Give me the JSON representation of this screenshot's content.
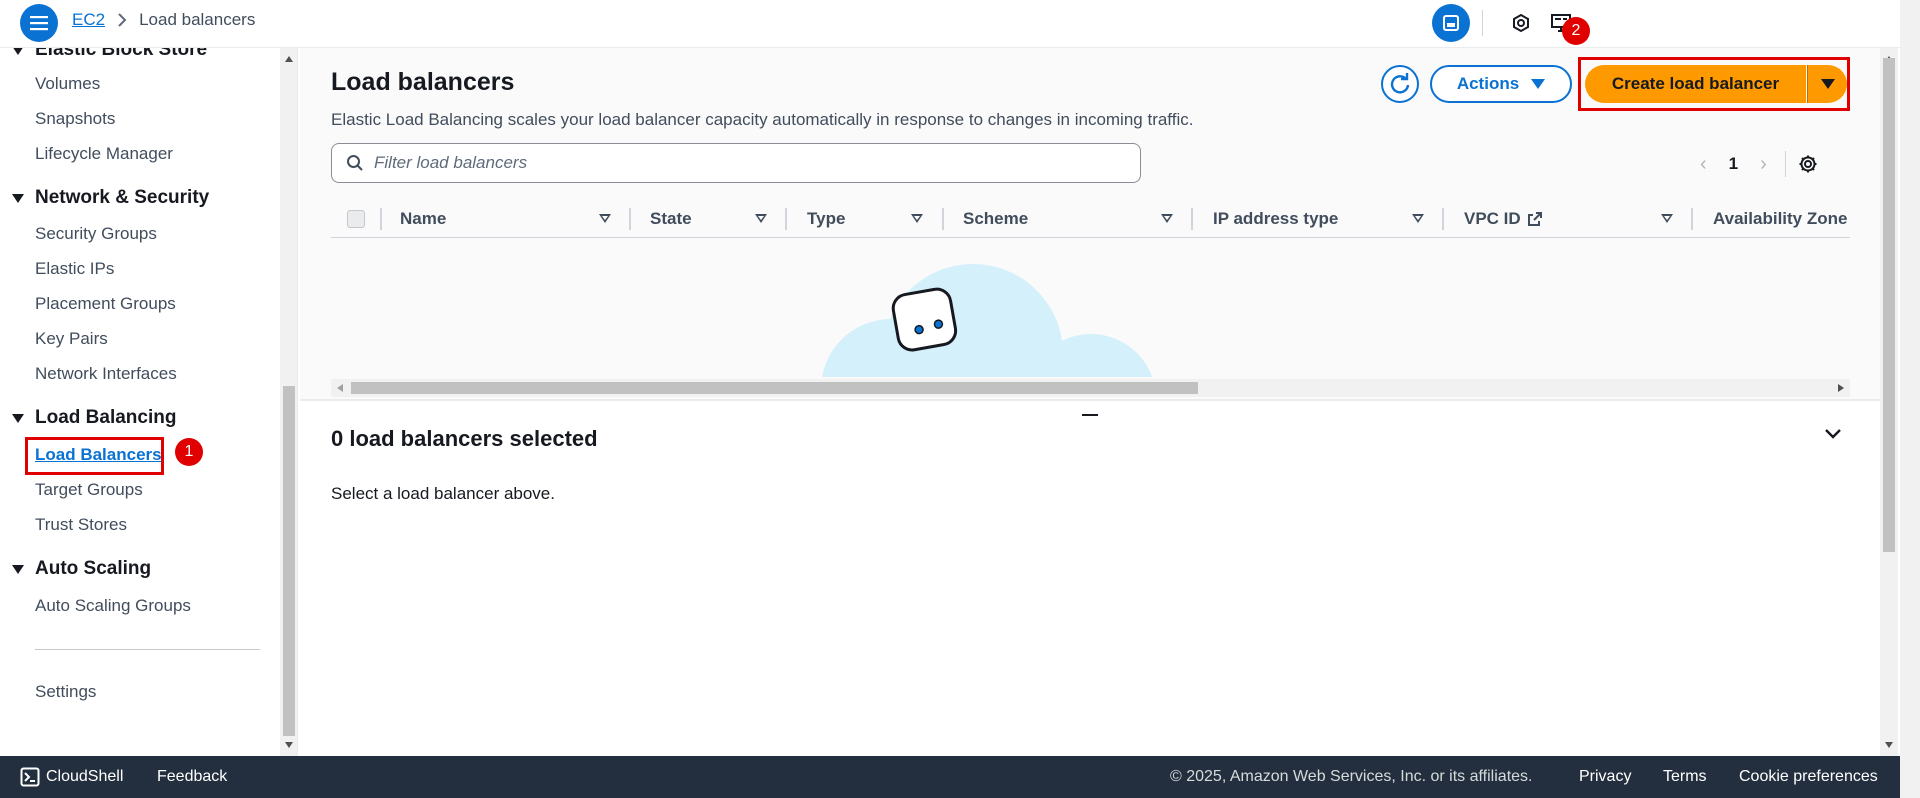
{
  "header": {
    "breadcrumb_root": "EC2",
    "breadcrumb_current": "Load balancers"
  },
  "sidebar": {
    "top_section_partial": "Elastic Block Store",
    "ebs_items": [
      "Volumes",
      "Snapshots",
      "Lifecycle Manager"
    ],
    "network_section": "Network & Security",
    "network_items": [
      "Security Groups",
      "Elastic IPs",
      "Placement Groups",
      "Key Pairs",
      "Network Interfaces"
    ],
    "lb_section": "Load Balancing",
    "lb_items": [
      "Load Balancers",
      "Target Groups",
      "Trust Stores"
    ],
    "as_section": "Auto Scaling",
    "as_items": [
      "Auto Scaling Groups"
    ],
    "settings": "Settings",
    "active_item": "Load Balancers"
  },
  "annotations": {
    "step1": "1",
    "step2": "2"
  },
  "main": {
    "title": "Load balancers",
    "description": "Elastic Load Balancing scales your load balancer capacity automatically in response to changes in incoming traffic.",
    "actions_label": "Actions",
    "create_label": "Create load balancer",
    "filter_placeholder": "Filter load balancers",
    "page_number": "1",
    "columns": [
      "Name",
      "State",
      "Type",
      "Scheme",
      "IP address type",
      "VPC ID",
      "Availability Zone"
    ],
    "selection_title": "0 load balancers selected",
    "selection_text": "Select a load balancer above."
  },
  "footer": {
    "cloudshell": "CloudShell",
    "feedback": "Feedback",
    "copyright": "© 2025, Amazon Web Services, Inc. or its affiliates.",
    "privacy": "Privacy",
    "terms": "Terms",
    "cookies": "Cookie preferences"
  },
  "colors": {
    "primary": "#0972d3",
    "create_button": "#ff9900",
    "highlight": "#e00000",
    "footer_bg": "#232f3e"
  }
}
